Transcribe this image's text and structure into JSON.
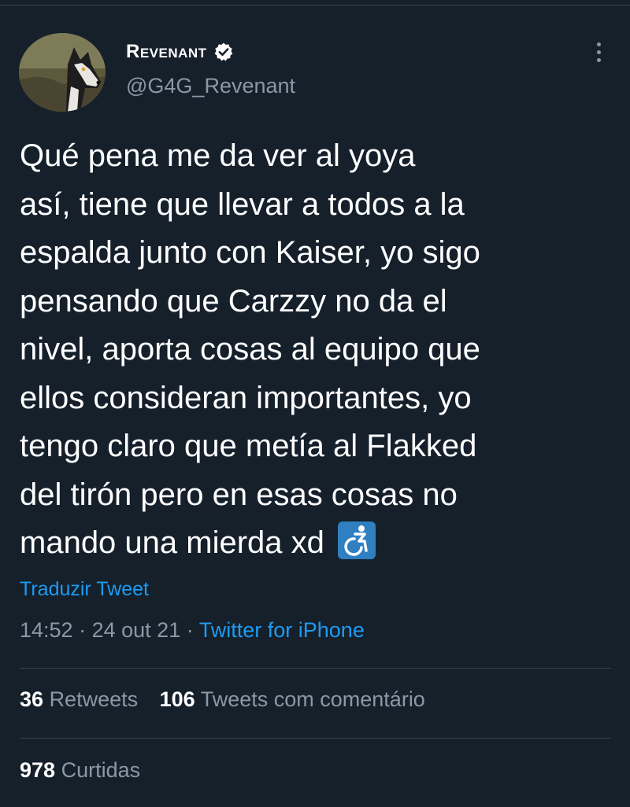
{
  "author": {
    "display_name": "Revenant",
    "username": "@G4G_Revenant",
    "avatar": "husky-avatar",
    "verified_icon": "verified-badge-icon"
  },
  "menu": {
    "more_icon": "more-vertical-icon"
  },
  "tweet": {
    "text": "Qué pena me da ver al yoya\nasí, tiene que llevar a todos a la\nespalda junto con Kaiser, yo sigo\npensando que Carzzy no da el\nnivel, aporta cosas al equipo que\nellos consideran importantes, yo\ntengo claro que metía al Flakked\ndel tirón pero en esas cosas no\nmando una mierda xd",
    "emoji": "wheelchair-icon",
    "translate_label": "Traduzir Tweet",
    "time": "14:52",
    "separator": "·",
    "date": "24 out 21",
    "source": "Twitter for iPhone"
  },
  "stats": {
    "retweets_count": "36",
    "retweets_label": "Retweets",
    "quotes_count": "106",
    "quotes_label": "Tweets com comentário",
    "likes_count": "978",
    "likes_label": "Curtidas"
  },
  "colors": {
    "background": "#15202b",
    "text": "#ffffff",
    "secondary_text": "#8b98a5",
    "accent": "#1d9bf0",
    "divider": "#38444d",
    "emoji_bg": "#2f7fc1"
  }
}
